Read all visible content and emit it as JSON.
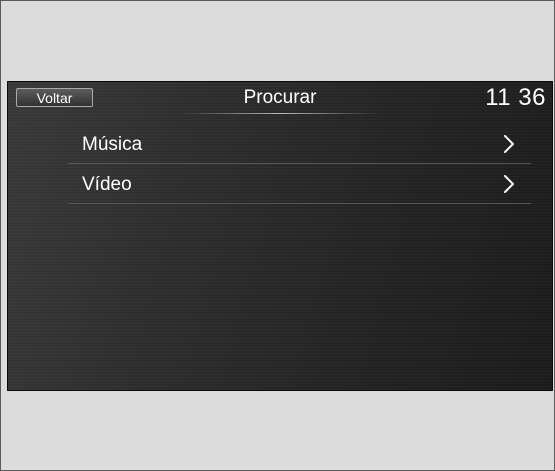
{
  "header": {
    "back_label": "Voltar",
    "title": "Procurar",
    "clock": "11 36"
  },
  "menu": {
    "items": [
      {
        "label": "Música",
        "icon": "chevron-right-icon"
      },
      {
        "label": "Vídeo",
        "icon": "chevron-right-icon"
      }
    ]
  },
  "colors": {
    "page_background": "#dcdcdc",
    "screen_background": "#2a2a2a",
    "text": "#ffffff",
    "divider": "#565656"
  }
}
